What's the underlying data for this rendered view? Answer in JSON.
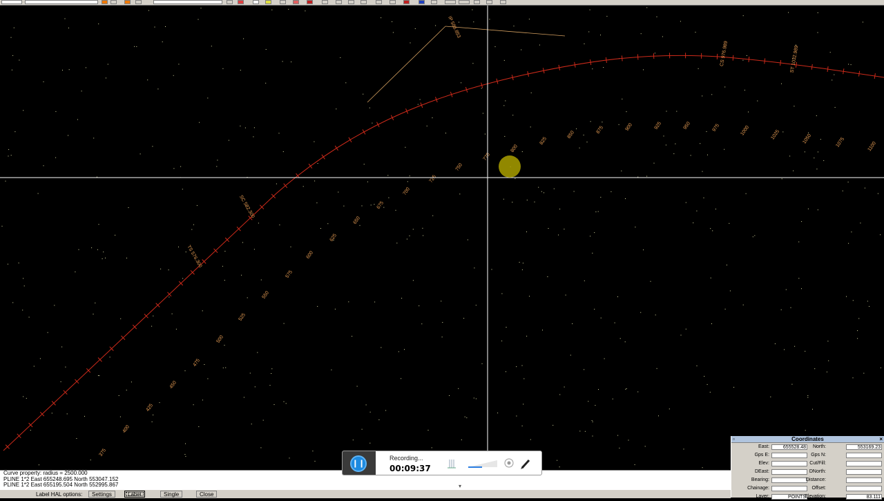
{
  "toolbar": {
    "combo1": "",
    "combo2": "",
    "combo3": ""
  },
  "colors": {
    "background": "#000000",
    "alignment": "#cc2a1a",
    "label": "#e39a52",
    "points": "#d8d8a0",
    "crosshair": "#ffffff"
  },
  "chainage_labels": [
    {
      "t": "375"
    },
    {
      "t": "400"
    },
    {
      "t": "425"
    },
    {
      "t": "450"
    },
    {
      "t": "475"
    },
    {
      "t": "500"
    },
    {
      "t": "525"
    },
    {
      "t": "550"
    },
    {
      "t": "575"
    },
    {
      "t": "600"
    },
    {
      "t": "625"
    },
    {
      "t": "650"
    },
    {
      "t": "675"
    },
    {
      "t": "700"
    },
    {
      "t": "725"
    },
    {
      "t": "750"
    },
    {
      "t": "775"
    },
    {
      "t": "800"
    },
    {
      "t": "825"
    },
    {
      "t": "850"
    },
    {
      "t": "875"
    },
    {
      "t": "900"
    },
    {
      "t": "925"
    },
    {
      "t": "950"
    },
    {
      "t": "975"
    },
    {
      "t": "1000"
    },
    {
      "t": "1025"
    },
    {
      "t": "1050"
    },
    {
      "t": "1075"
    },
    {
      "t": "1100"
    }
  ],
  "ip_labels": [
    {
      "t": "TS 576.300"
    },
    {
      "t": "SC 582.300"
    },
    {
      "t": "CS 976.989"
    },
    {
      "t": "ST 1032.989"
    },
    {
      "t": "IP 586.853"
    }
  ],
  "command_lines": [
    "Curve property: radius = 2500.000",
    "PLINE 1*2  East 655248.695  North 553047.152",
    "PLINE 1*2  East 655195.504  North 552995.867"
  ],
  "bottom_bar": {
    "options_label": "Label HAL options:",
    "buttons": [
      "Settings",
      "Label",
      "Single",
      "Close"
    ],
    "active_button": "Label"
  },
  "coordinates_panel": {
    "title": "Coordinates",
    "left": [
      {
        "label": "East:",
        "value": "655528.48"
      },
      {
        "label": "Gps E:",
        "value": ""
      },
      {
        "label": "Elev:",
        "value": ""
      },
      {
        "label": "DEast:",
        "value": ""
      },
      {
        "label": "Bearing:",
        "value": ""
      },
      {
        "label": "Chainage:",
        "value": ""
      },
      {
        "label": "Layer:",
        "value": "POINTS"
      }
    ],
    "right": [
      {
        "label": "North:",
        "value": "553169.23"
      },
      {
        "label": "Gps N:",
        "value": ""
      },
      {
        "label": "Cut/Fill:",
        "value": ""
      },
      {
        "label": "DNorth:",
        "value": ""
      },
      {
        "label": "Distance:",
        "value": ""
      },
      {
        "label": "Offset:",
        "value": ""
      },
      {
        "label": "Elevation:",
        "value": "83.111"
      }
    ]
  },
  "recorder": {
    "status": "Recording...",
    "time": "00:09:37"
  }
}
